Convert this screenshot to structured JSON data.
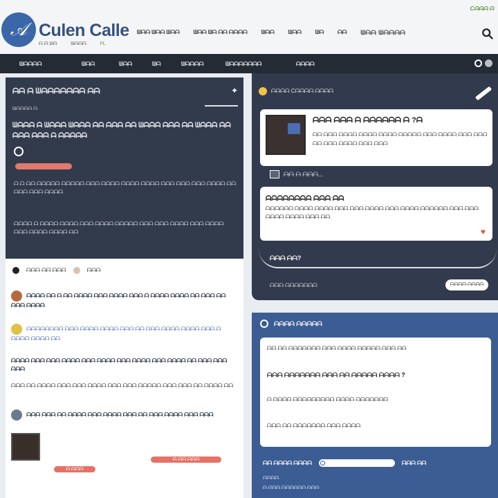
{
  "header": {
    "brand": "Culen Calle",
    "sub_left": "ᗩ ᗩ ᗯᗩ",
    "sub_mid": "ᗯᗩᗩᗩ",
    "sub_right": "ᖴᒪ",
    "nav": [
      "ᗯᗩᗩ ᗯᗩᗩ ᗯᗩᗩ",
      "ᗯᗩᗩ ᗯᗩ ᗩᗩ ᗩᗩᗩᗩ",
      "ᗯᗩᗩ",
      "ᗯᗩᗩ",
      "ᗯᗩ",
      "ᗩᗩ",
      "ᗯᗩᗩ ᗯᗩᗩᗩᗩ"
    ],
    "corner": "Cᗩᗩᗩ ᗩ"
  },
  "navbar": {
    "items": [
      "ᗯᗩᗩᗩᗩ",
      "ᗯᗩᗩ",
      "ᗯᗩᗩ",
      "ᗯᗩ",
      "ᗯᗩᗩᗩᗩ",
      "ᗯᗩᗩᗩᗩᗩᗩᗩ",
      "ᗩᗩᗩᗩ"
    ]
  },
  "hero": {
    "title": "ᗩᗩ ᗩ ᗯᗩᗩᗩᗩᗩᗩᗩ ᗩᗩ",
    "meta": "ᗯᗩᗩᗩᗩ ᗩ",
    "headline": "ᗯᗩᗩᗩ ᗩ ᗯᗩᗩᗩ ᗯᗩᗩᗩ ᗩᗩ ᗩᗩᗩ ᗩᗩ ᗯᗩᗩᗩ ᗩᗩᗩ ᗩᗩ ᗯᗩᗩᗩ ᗩᗩ ᗩᗩᗩ ᗩᗩᗩ ᗩ ᗩᗩᗩᗩᗩ",
    "para1": "ᗩ ᗩ ᗩᗩ ᗩᗩᗩᗩᗩ ᗩᗩᗩᗩᗩ ᗩᗩᗩ ᗩᗩᗩᗩ ᗩᗩᗩᗩ ᗩᗩᗩᗩ ᗩᗩᗩ ᗩᗩᗩ ᗩᗩᗩ ᗩᗩᗩᗩ ᗩᗩ ᗩᗩᗩ ᗩᗩᗩ ᗩᗩᗩᗩ",
    "para2": "ᗩᗩᗩᗩ ᗩ ᗩᗩᗩᗩ ᗩᗩᗩᗩ ᗩᗩᗩ ᗩᗩᗩᗩ ᗩᗩᗩᗩᗩ ᗩᗩᗩ ᗩᗩᗩ ᗩᗩᗩᗩ ᗩᗩᗩ ᗩᗩᗩᗩ ᗩᗩᗩ ᗩᗩᗩᗩ ᗩᗩᗩᗩ ᗩᗩ"
  },
  "feed": {
    "head_label": "ᗩᗩᗩ ᗩᗩ ᗩᗩᗩ",
    "head_right": "ᗩᗩᗩ",
    "items": [
      "ᗩᗩᗩᗩ ᗩᗩ ᗩ ᗩᗩ ᗩᗩᗩᗩ ᗩᗩᗩ ᗩᗩᗩᗩ ᗩᗩᗩ ᗩ ᗩᗩᗩᗩ ᗩᗩᗩᗩ ᗩᗩ ᗩᗩᗩ ᗩᗩ ᗩᗩᗩ ᗩᗩᗩᗩ",
      "ᗩᗩᗩᗩᗩᗩᗩᗩ ᗩᗩᗩ ᗩᗩᗩᗩ ᗩᗩᗩᗩ ᗩᗩᗩ ᗩᗩ ᗩᗩᗩ ᗩᗩᗩᗩ ᗩᗩᗩᗩ ᗩᗩᗩ ᗩ ᗩᗩᗩᗩ ᗩᗩᗩᗩ ᗩᗩ",
      "ᗩᗩᗩᗩ ᗩᗩᗩ ᗩᗩᗩ ᗩᗩᗩᗩ ᗩᗩᗩ ᗩᗩᗩᗩ ᗩᗩᗩ ᗩᗩᗩᗩ ᗩᗩᗩ ᗩᗩᗩᗩ ᗩᗩ ᗩᗩᗩ ᗩᗩᗩ ᗩᗩᗩ",
      "ᗩᗩᗩ ᗩᗩ ᗩᗩᗩᗩ ᗩᗩᗩ ᗩᗩᗩ ᗩᗩᗩᗩ ᗩᗩᗩ ᗩᗩᗩ ᗩᗩᗩᗩᗩ ᗩᗩᗩ ᗩᗩᗩ ᗩᗩ ᗩᗩᗩᗩ ᗩᗩ",
      "ᗩᗩᗩ ᗩᗩᗩ ᗩᗩ ᗩᗩᗩᗩ ᗩᗩᗩ ᗩᗩᗩᗩ ᗩᗩᗩ ᗩᗩ ᗩᗩᗩ ᗩᗩᗩᗩ ᗩᗩᗩ ᗩᗩᗩ"
    ],
    "pill_label": "ᗩ ᗩᗩ ᗩᗩᗩ",
    "pill2_label": "ᗩ ᗩᗩᗩ"
  },
  "right_top": {
    "head": "ᗩᗩᗩᗩ Cᗩᗩᗩᗩ ᗩᗩᗩᗩ",
    "card1_title": "ᗩᗩᗩ ᗩᗩᗩ ᗩ ᗩᗩᗩᗩᗩᗩ ᗩ ?ᗩ",
    "card1_desc": "ᗩᗩ ᗩᗩᗩ ᗩᗩᗩᗩ ᗩᗩᗩᗩ ᗩᗩᗩᗩ ᗩᗩᗩᗩᗩ ᗩᗩᗩ ᗩᗩᗩᗩ ᗩᗩᗩ ᗩᗩᗩ ᗩᗩ ᗩᗩᗩ ᗩᗩᗩᗩ ᗩᗩᗩ ᗩᗩᗩ",
    "mid_label": "ᗩᗩ ᗩ ᗩᗩᗩ...",
    "card2_title": "ᗩᗩᗩᗩᗩᗩᗩᗩ ᗩᗩᗩ ᗩᗩ",
    "card2_desc": "ᗩᗩᗩᗩᗩᗩ ᗩᗩᗩᗩ ᗩᗩᗩᗩ ᗩᗩᗩ ᗩᗩᗩ ᗩᗩᗩᗩ ᗩᗩᗩ ᗩᗩᗩᗩ ᗩᗩᗩᗩᗩᗩ ᗩᗩᗩ ᗩᗩᗩ ᗩᗩᗩᗩ ᗩᗩᗩᗩ ᗩᗩᗩ ᗩᗩ",
    "arc_label": "ᗩᗩᗩ ᗩᗩ?",
    "foot": "ᗩᗩᗩ ᗩᗩᗩᗩᗩᗩᗩ",
    "btn": "ᗩᗩᗩᗩ ᗩᗩᗩᗩ"
  },
  "right_bot": {
    "head": "ᗩᗩᗩᗩ ᗩᗩᗩᗩᗩ",
    "line1": "ᗩᗩ ᗩᗩ ᗩᗩᗩᗩᗩᗩᗩ ᗩᗩᗩ ᗩᗩᗩᗩ ᗩᗩᗩᗩᗩ ᗩᗩᗩ ᗩᗩ",
    "line2": "ᗩᗩᗩ ᗩᗩᗩᗩᗩᗩᗩ ᗩᗩᗩ ᗩᗩ ᗩᗩᗩᗩᗩ ᗩᗩᗩᗩ ?",
    "line3": "ᗩ ᗩᗩᗩᗩ ᗩᗩᗩᗩᗩᗩᗩᗩᗩ ᗩᗩᗩᗩ ᗩᗩᗩᗩᗩᗩᗩ",
    "line4": "ᗩᗩᗩ ᗩᗩ ᗩᗩᗩᗩᗩᗩᗩ ᗩᗩᗩ ᗩᗩᗩᗩ",
    "bar_label": "ᗩᗩ ᗩᗩᗩᗩ ᗩᗩᗩᗩ",
    "bar_right": "ᗩᗩᗩ ᗩᗩ",
    "foot1": "ᗩᗩᗩᗩ",
    "foot2": "ᗩ ᗩᗩᗩ ᗩᗩᗩᗩᗩᗩ ᗩᗩᗩ"
  }
}
